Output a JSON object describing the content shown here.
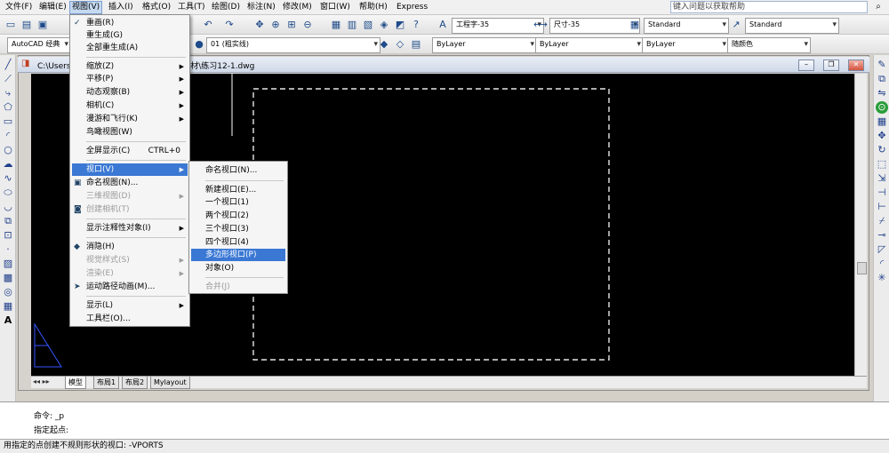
{
  "menubar": {
    "items": [
      "文件(F)",
      "编辑(E)",
      "视图(V)",
      "插入(I)",
      "格式(O)",
      "工具(T)",
      "绘图(D)",
      "标注(N)",
      "修改(M)",
      "窗口(W)",
      "帮助(H)",
      "Express"
    ],
    "help_search_placeholder": "键入问题以获取帮助"
  },
  "toolbar1": {
    "text_style": "工程字-35",
    "dim_style": "尺寸-35",
    "table_style": "Standard",
    "mleader_style": "Standard"
  },
  "toolbar2": {
    "workspace": "AutoCAD 经典",
    "layer": "01 (粗实线)",
    "color": "ByLayer",
    "linetype": "ByLayer",
    "lineweight": "ByLayer",
    "plot_style": "随颜色"
  },
  "document": {
    "title": "C:\\Users\\...\\AutoCAD 2008基础教程》素材\\练习12-1.dwg"
  },
  "view_menu": {
    "items": [
      {
        "label": "重画(R)",
        "shortcut": "",
        "submenu": false,
        "disabled": false,
        "icon": "redraw-icon"
      },
      {
        "label": "重生成(G)",
        "shortcut": "",
        "submenu": false,
        "disabled": false,
        "icon": ""
      },
      {
        "label": "全部重生成(A)",
        "shortcut": "",
        "submenu": false,
        "disabled": false,
        "icon": ""
      },
      {
        "label": "缩放(Z)",
        "shortcut": "",
        "submenu": true,
        "disabled": false,
        "icon": ""
      },
      {
        "label": "平移(P)",
        "shortcut": "",
        "submenu": true,
        "disabled": false,
        "icon": ""
      },
      {
        "label": "动态观察(B)",
        "shortcut": "",
        "submenu": true,
        "disabled": false,
        "icon": ""
      },
      {
        "label": "相机(C)",
        "shortcut": "",
        "submenu": true,
        "disabled": false,
        "icon": ""
      },
      {
        "label": "漫游和飞行(K)",
        "shortcut": "",
        "submenu": true,
        "disabled": false,
        "icon": ""
      },
      {
        "label": "鸟瞰视图(W)",
        "shortcut": "",
        "submenu": false,
        "disabled": false,
        "icon": ""
      },
      {
        "label": "全屏显示(C)",
        "shortcut": "CTRL+0",
        "submenu": false,
        "disabled": false,
        "icon": ""
      },
      {
        "label": "视口(V)",
        "shortcut": "",
        "submenu": true,
        "disabled": false,
        "icon": ""
      },
      {
        "label": "命名视图(N)...",
        "shortcut": "",
        "submenu": false,
        "disabled": false,
        "icon": "named-view-icon"
      },
      {
        "label": "三维视图(D)",
        "shortcut": "",
        "submenu": true,
        "disabled": true,
        "icon": ""
      },
      {
        "label": "创建相机(T)",
        "shortcut": "",
        "submenu": false,
        "disabled": true,
        "icon": "camera-icon"
      },
      {
        "label": "显示注释性对象(I)",
        "shortcut": "",
        "submenu": true,
        "disabled": false,
        "icon": ""
      },
      {
        "label": "消隐(H)",
        "shortcut": "",
        "submenu": false,
        "disabled": false,
        "icon": "hide-icon"
      },
      {
        "label": "视觉样式(S)",
        "shortcut": "",
        "submenu": true,
        "disabled": true,
        "icon": ""
      },
      {
        "label": "渲染(E)",
        "shortcut": "",
        "submenu": true,
        "disabled": true,
        "icon": ""
      },
      {
        "label": "运动路径动画(M)...",
        "shortcut": "",
        "submenu": false,
        "disabled": false,
        "icon": "motion-path-icon"
      },
      {
        "label": "显示(L)",
        "shortcut": "",
        "submenu": true,
        "disabled": false,
        "icon": ""
      },
      {
        "label": "工具栏(O)...",
        "shortcut": "",
        "submenu": false,
        "disabled": false,
        "icon": ""
      }
    ]
  },
  "viewport_submenu": {
    "items": [
      {
        "label": "命名视口(N)...",
        "disabled": false
      },
      {
        "label": "新建视口(E)...",
        "disabled": false
      },
      {
        "label": "一个视口(1)",
        "disabled": false
      },
      {
        "label": "两个视口(2)",
        "disabled": false
      },
      {
        "label": "三个视口(3)",
        "disabled": false
      },
      {
        "label": "四个视口(4)",
        "disabled": false
      },
      {
        "label": "多边形视口(P)",
        "disabled": false
      },
      {
        "label": "对象(O)",
        "disabled": false
      },
      {
        "label": "合并(J)",
        "disabled": true
      }
    ]
  },
  "layout_tabs": [
    "模型",
    "布局1",
    "布局2",
    "Mylayout"
  ],
  "command": {
    "line1": "命令: _p",
    "line2": "指定起点:"
  },
  "status_text": "用指定的点创建不规则形状的视口:  -VPORTS",
  "colors": {
    "canvas": "#000000",
    "highlight": "#3a78d4",
    "dashed_rect": "#e6e6e6"
  }
}
